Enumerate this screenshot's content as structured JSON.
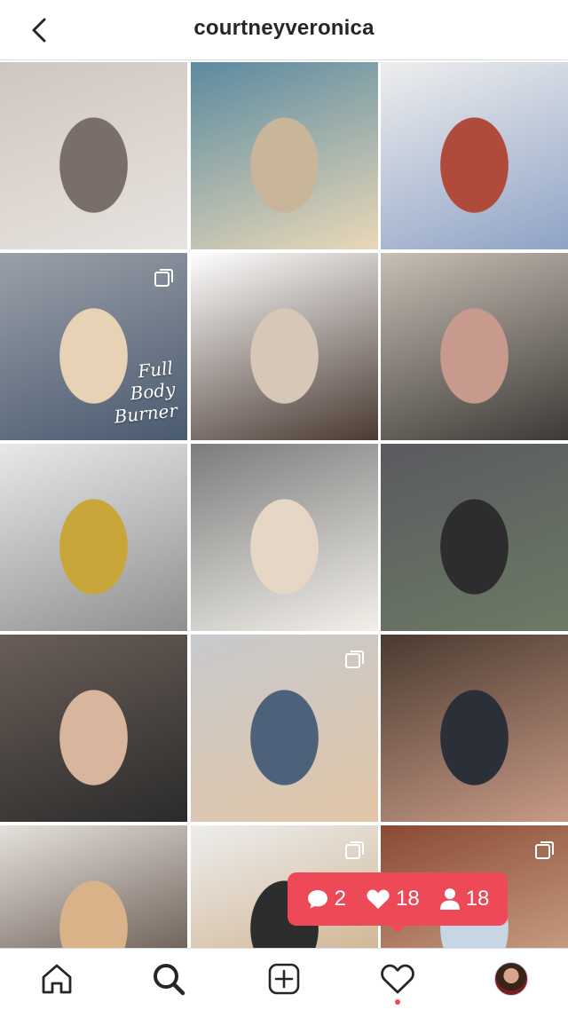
{
  "header": {
    "username": "courtneyveronica"
  },
  "grid": {
    "posts": [
      {
        "colors": [
          "#cfc6c1",
          "#7a6e68",
          "#e8e3df"
        ],
        "multi": false,
        "caption": ""
      },
      {
        "colors": [
          "#5b8aa0",
          "#c8b59a",
          "#e9d8b8"
        ],
        "multi": false,
        "caption": ""
      },
      {
        "colors": [
          "#eeeeee",
          "#b04a3b",
          "#8fa3c6"
        ],
        "multi": false,
        "caption": ""
      },
      {
        "colors": [
          "#9aa0a8",
          "#e8d2b6",
          "#4a5a70"
        ],
        "multi": true,
        "caption": "Full\nBody\nBurner"
      },
      {
        "colors": [
          "#ffffff",
          "#d7c7b6",
          "#4a3a32"
        ],
        "multi": false,
        "caption": ""
      },
      {
        "colors": [
          "#c8bfb5",
          "#c79a8d",
          "#3d3a36"
        ],
        "multi": false,
        "caption": ""
      },
      {
        "colors": [
          "#e6e8ea",
          "#c8a63a",
          "#8f8f8f"
        ],
        "multi": false,
        "caption": ""
      },
      {
        "colors": [
          "#7c7c7c",
          "#e6d6c6",
          "#f3f0ea"
        ],
        "multi": false,
        "caption": ""
      },
      {
        "colors": [
          "#5a5a60",
          "#2d2d2d",
          "#6c7a64"
        ],
        "multi": false,
        "caption": ""
      },
      {
        "colors": [
          "#6a5e57",
          "#d8b69d",
          "#2b2b2b"
        ],
        "multi": false,
        "caption": ""
      },
      {
        "colors": [
          "#c7c9cc",
          "#4d627a",
          "#e2c6a7"
        ],
        "multi": true,
        "caption": ""
      },
      {
        "colors": [
          "#4a3a30",
          "#2b2f38",
          "#c89a86"
        ],
        "multi": false,
        "caption": ""
      },
      {
        "colors": [
          "#e6e1dc",
          "#d9b28a",
          "#4a3a30"
        ],
        "multi": false,
        "caption": ""
      },
      {
        "colors": [
          "#ededed",
          "#2d2d2d",
          "#c8a67a"
        ],
        "multi": true,
        "caption": ""
      },
      {
        "colors": [
          "#8a4a32",
          "#c7d6e4",
          "#d8b59a"
        ],
        "multi": true,
        "caption": ""
      }
    ]
  },
  "activity": {
    "comments": "2",
    "likes": "18",
    "follows": "18",
    "color": "#ed4956"
  },
  "tabs": [
    {
      "icon": "home-icon"
    },
    {
      "icon": "search-icon"
    },
    {
      "icon": "add-post-icon"
    },
    {
      "icon": "heart-icon"
    },
    {
      "icon": "profile-avatar"
    }
  ]
}
